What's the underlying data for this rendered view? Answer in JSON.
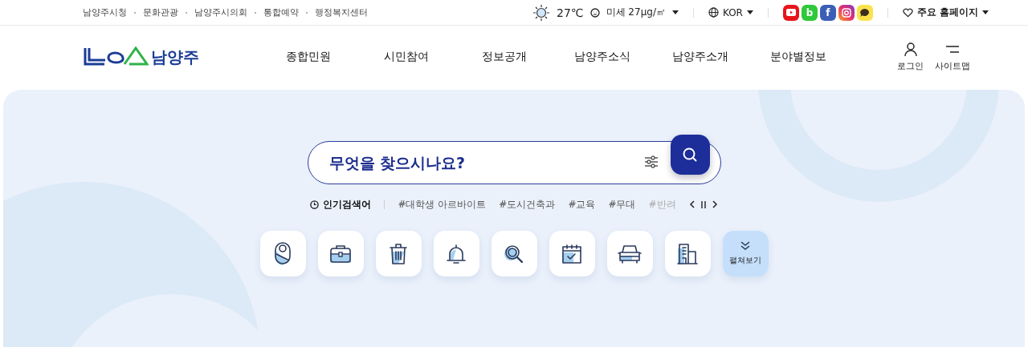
{
  "top_links": [
    "남양주시청",
    "문화관광",
    "남양주시의회",
    "통합예약",
    "행정복지센터"
  ],
  "weather": {
    "temperature": "27℃",
    "dust": "미세 27μg/㎥"
  },
  "language": {
    "label": "KOR"
  },
  "social": [
    {
      "kind": "youtube"
    },
    {
      "kind": "blog",
      "label": "b"
    },
    {
      "kind": "facebook",
      "label": "f"
    },
    {
      "kind": "instagram"
    },
    {
      "kind": "kakao"
    }
  ],
  "homepages": {
    "label": "주요 홈페이지"
  },
  "logo": {
    "text": "남양주"
  },
  "nav": [
    "종합민원",
    "시민참여",
    "정보공개",
    "남양주소식",
    "남양주소개",
    "분야별정보"
  ],
  "utility": [
    {
      "kind": "login",
      "label": "로그인"
    },
    {
      "kind": "sitemap",
      "label": "사이트맵"
    }
  ],
  "search": {
    "placeholder": "무엇을 찾으시나요?"
  },
  "popular": {
    "label": "인기검색어",
    "keywords": [
      "#대학생 아르바이트",
      "#도시건축과",
      "#교육",
      "#무대",
      "#반려"
    ]
  },
  "quick_links": [
    {
      "kind": "baby"
    },
    {
      "kind": "briefcase"
    },
    {
      "kind": "trash"
    },
    {
      "kind": "bell"
    },
    {
      "kind": "magnifier"
    },
    {
      "kind": "calendar"
    },
    {
      "kind": "car"
    },
    {
      "kind": "building"
    },
    {
      "kind": "more",
      "label": "펼쳐보기"
    }
  ]
}
